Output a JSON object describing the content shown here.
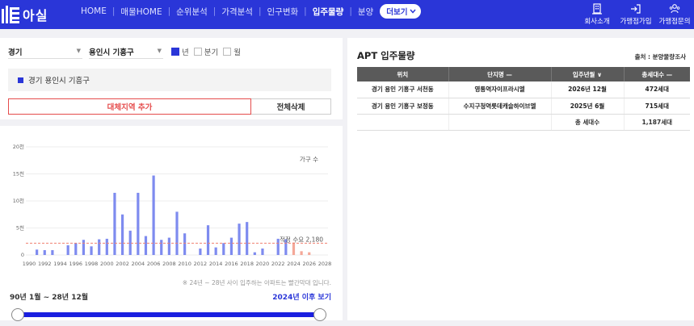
{
  "app": {
    "logo_text": "아실"
  },
  "nav": {
    "items": [
      {
        "label": "HOME",
        "active": false
      },
      {
        "label": "매물HOME",
        "active": false
      },
      {
        "label": "순위분석",
        "active": false
      },
      {
        "label": "가격분석",
        "active": false
      },
      {
        "label": "인구변화",
        "active": false
      },
      {
        "label": "입주물량",
        "active": true
      },
      {
        "label": "분양",
        "active": false
      }
    ],
    "more_label": "더보기"
  },
  "top_links": [
    {
      "label": "회사소개",
      "icon": "building-icon"
    },
    {
      "label": "가맹점가입",
      "icon": "login-icon"
    },
    {
      "label": "가맹점문의",
      "icon": "people-icon"
    }
  ],
  "filters": {
    "province": "경기",
    "city": "용인시 기흥구",
    "period_options": [
      {
        "label": "년",
        "checked": true
      },
      {
        "label": "분기",
        "checked": false
      },
      {
        "label": "월",
        "checked": false
      }
    ]
  },
  "selected_region": "경기 용인시 기흥구",
  "buttons": {
    "add_region": "대체지역 추가",
    "delete_all": "전체삭제"
  },
  "chart_data": {
    "type": "bar",
    "legend": "가구 수",
    "y_ticks": [
      "0",
      "5천",
      "10천",
      "15천",
      "20천"
    ],
    "ylim": [
      0,
      20000
    ],
    "x_tick_labels": [
      "1990",
      "1992",
      "1994",
      "1996",
      "1998",
      "2000",
      "2002",
      "2004",
      "2006",
      "2008",
      "2010",
      "2012",
      "2014",
      "2016",
      "2018",
      "2020",
      "2022",
      "2024",
      "2026",
      "2028"
    ],
    "categories": [
      1990,
      1991,
      1992,
      1993,
      1994,
      1995,
      1996,
      1997,
      1998,
      1999,
      2000,
      2001,
      2002,
      2003,
      2004,
      2005,
      2006,
      2007,
      2008,
      2009,
      2010,
      2011,
      2012,
      2013,
      2014,
      2015,
      2016,
      2017,
      2018,
      2019,
      2020,
      2021,
      2022,
      2023,
      2024,
      2025,
      2026,
      2027,
      2028
    ],
    "values": [
      0,
      1000,
      900,
      900,
      0,
      1800,
      2200,
      2800,
      1600,
      2900,
      3000,
      11500,
      7500,
      4500,
      11500,
      3500,
      14700,
      2800,
      3200,
      8000,
      4000,
      0,
      1200,
      5500,
      1400,
      2200,
      3200,
      5800,
      6100,
      500,
      1200,
      0,
      3000,
      2900,
      2300,
      700,
      500,
      0,
      0
    ],
    "future_from": 2024,
    "colors": {
      "past": "#7e8bef",
      "future": "#f4a898",
      "demand_line": "#f08070"
    },
    "demand_label": "적정 수요 2,180",
    "demand_value": 2180
  },
  "chart_note": "※ 24년 ~ 28년 사이 입주하는 아파트는 빨간막대 입니다.",
  "range": {
    "label": "90년 1월 ~ 28년 12월",
    "after_link": "2024년 이후 보기"
  },
  "apt": {
    "title": "APT 입주물량",
    "source": "출처 : 분양물량조사",
    "headers": [
      "위치",
      "단지명 —",
      "입주년월 ∨",
      "총세대수 —"
    ],
    "rows": [
      {
        "location": "경기 용인 기흥구 서천동",
        "name": "영통역자이프라시엘",
        "date": "2026년 12월",
        "units": "472세대"
      },
      {
        "location": "경기 용인 기흥구 보정동",
        "name": "수지구청역롯데캐슬하이브엘",
        "date": "2025년 6월",
        "units": "715세대"
      }
    ],
    "total": {
      "label": "총 세대수",
      "value": "1,187세대"
    }
  }
}
